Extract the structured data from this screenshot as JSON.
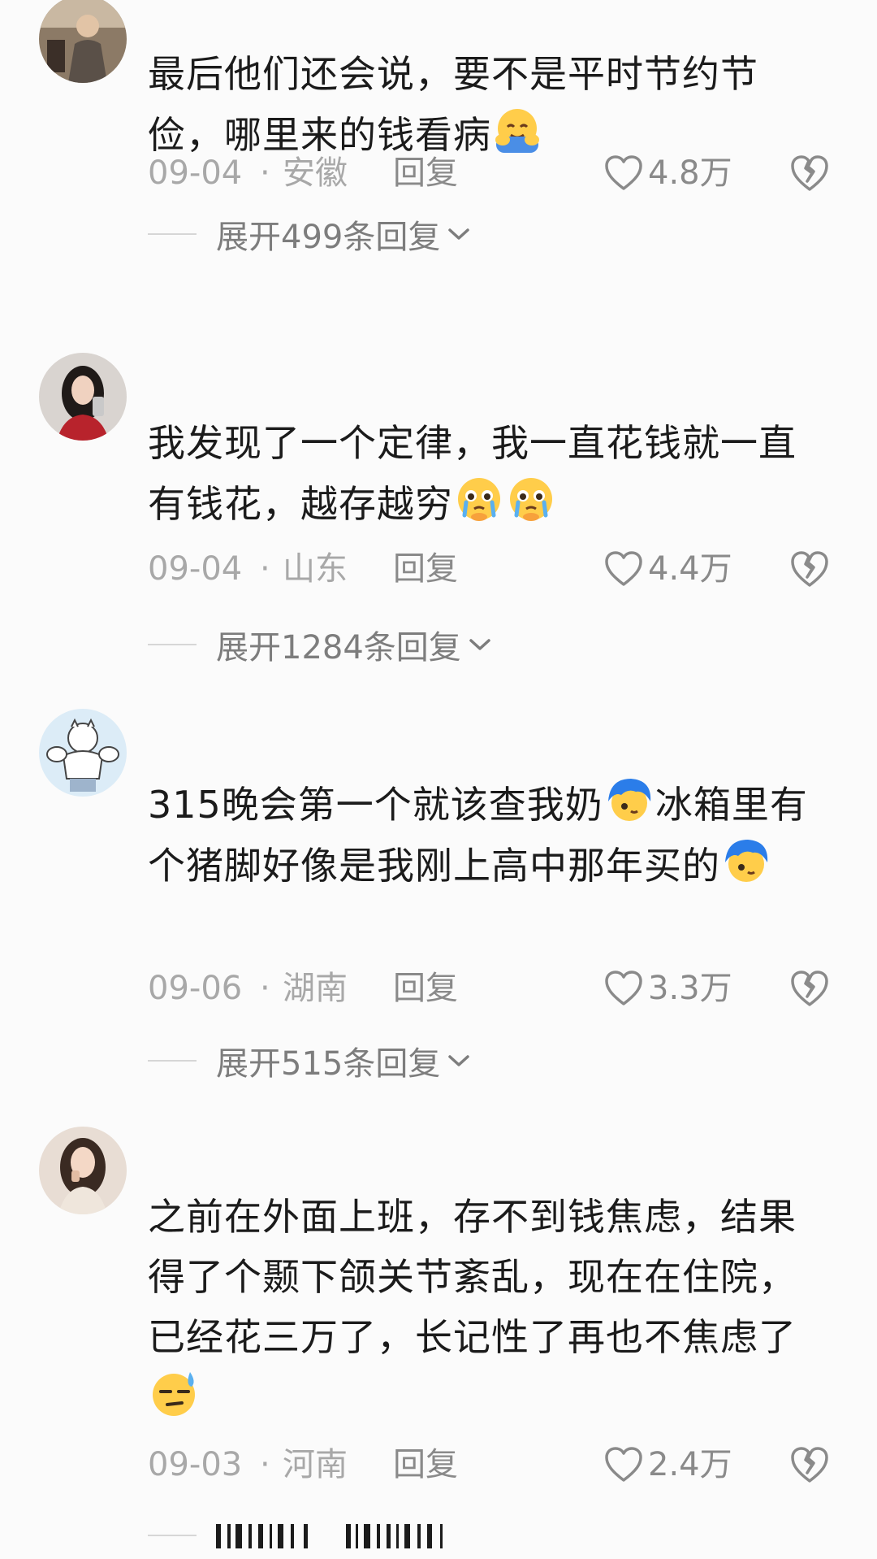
{
  "comments": [
    {
      "text": "最后他们还会说，要不是平时节约节俭，哪里来的钱看病",
      "emoji": "hugging-face",
      "date": "09-04",
      "location": "安徽",
      "reply": "回复",
      "likes": "4.8万",
      "expand": "展开499条回复"
    },
    {
      "text": "我发现了一个定律，我一直花钱就一直有钱花，越存越穷",
      "emoji": "pleading-crying-face",
      "date": "09-04",
      "location": "山东",
      "reply": "回复",
      "likes": "4.4万",
      "expand": "展开1284条回复"
    },
    {
      "text_a": "315晚会第一个就该查我奶",
      "text_b": "冰箱里有个猪脚好像是我刚上高中那年买的",
      "emoji": "blue-hair-peeking-face",
      "date": "09-06",
      "location": "湖南",
      "reply": "回复",
      "likes": "3.3万",
      "expand": "展开515条回复"
    },
    {
      "text": "之前在外面上班，存不到钱焦虑，结果得了个颞下颌关节紊乱，现在在住院，已经花三万了，长记性了再也不焦虑了",
      "emoji": "sweat-face",
      "date": "09-03",
      "location": "河南",
      "reply": "回复",
      "likes": "2.4万"
    }
  ],
  "meta_separator": "·",
  "colors": {
    "background": "#fbfbfb",
    "text": "#1b1b1b",
    "meta": "#a8a8a8"
  }
}
